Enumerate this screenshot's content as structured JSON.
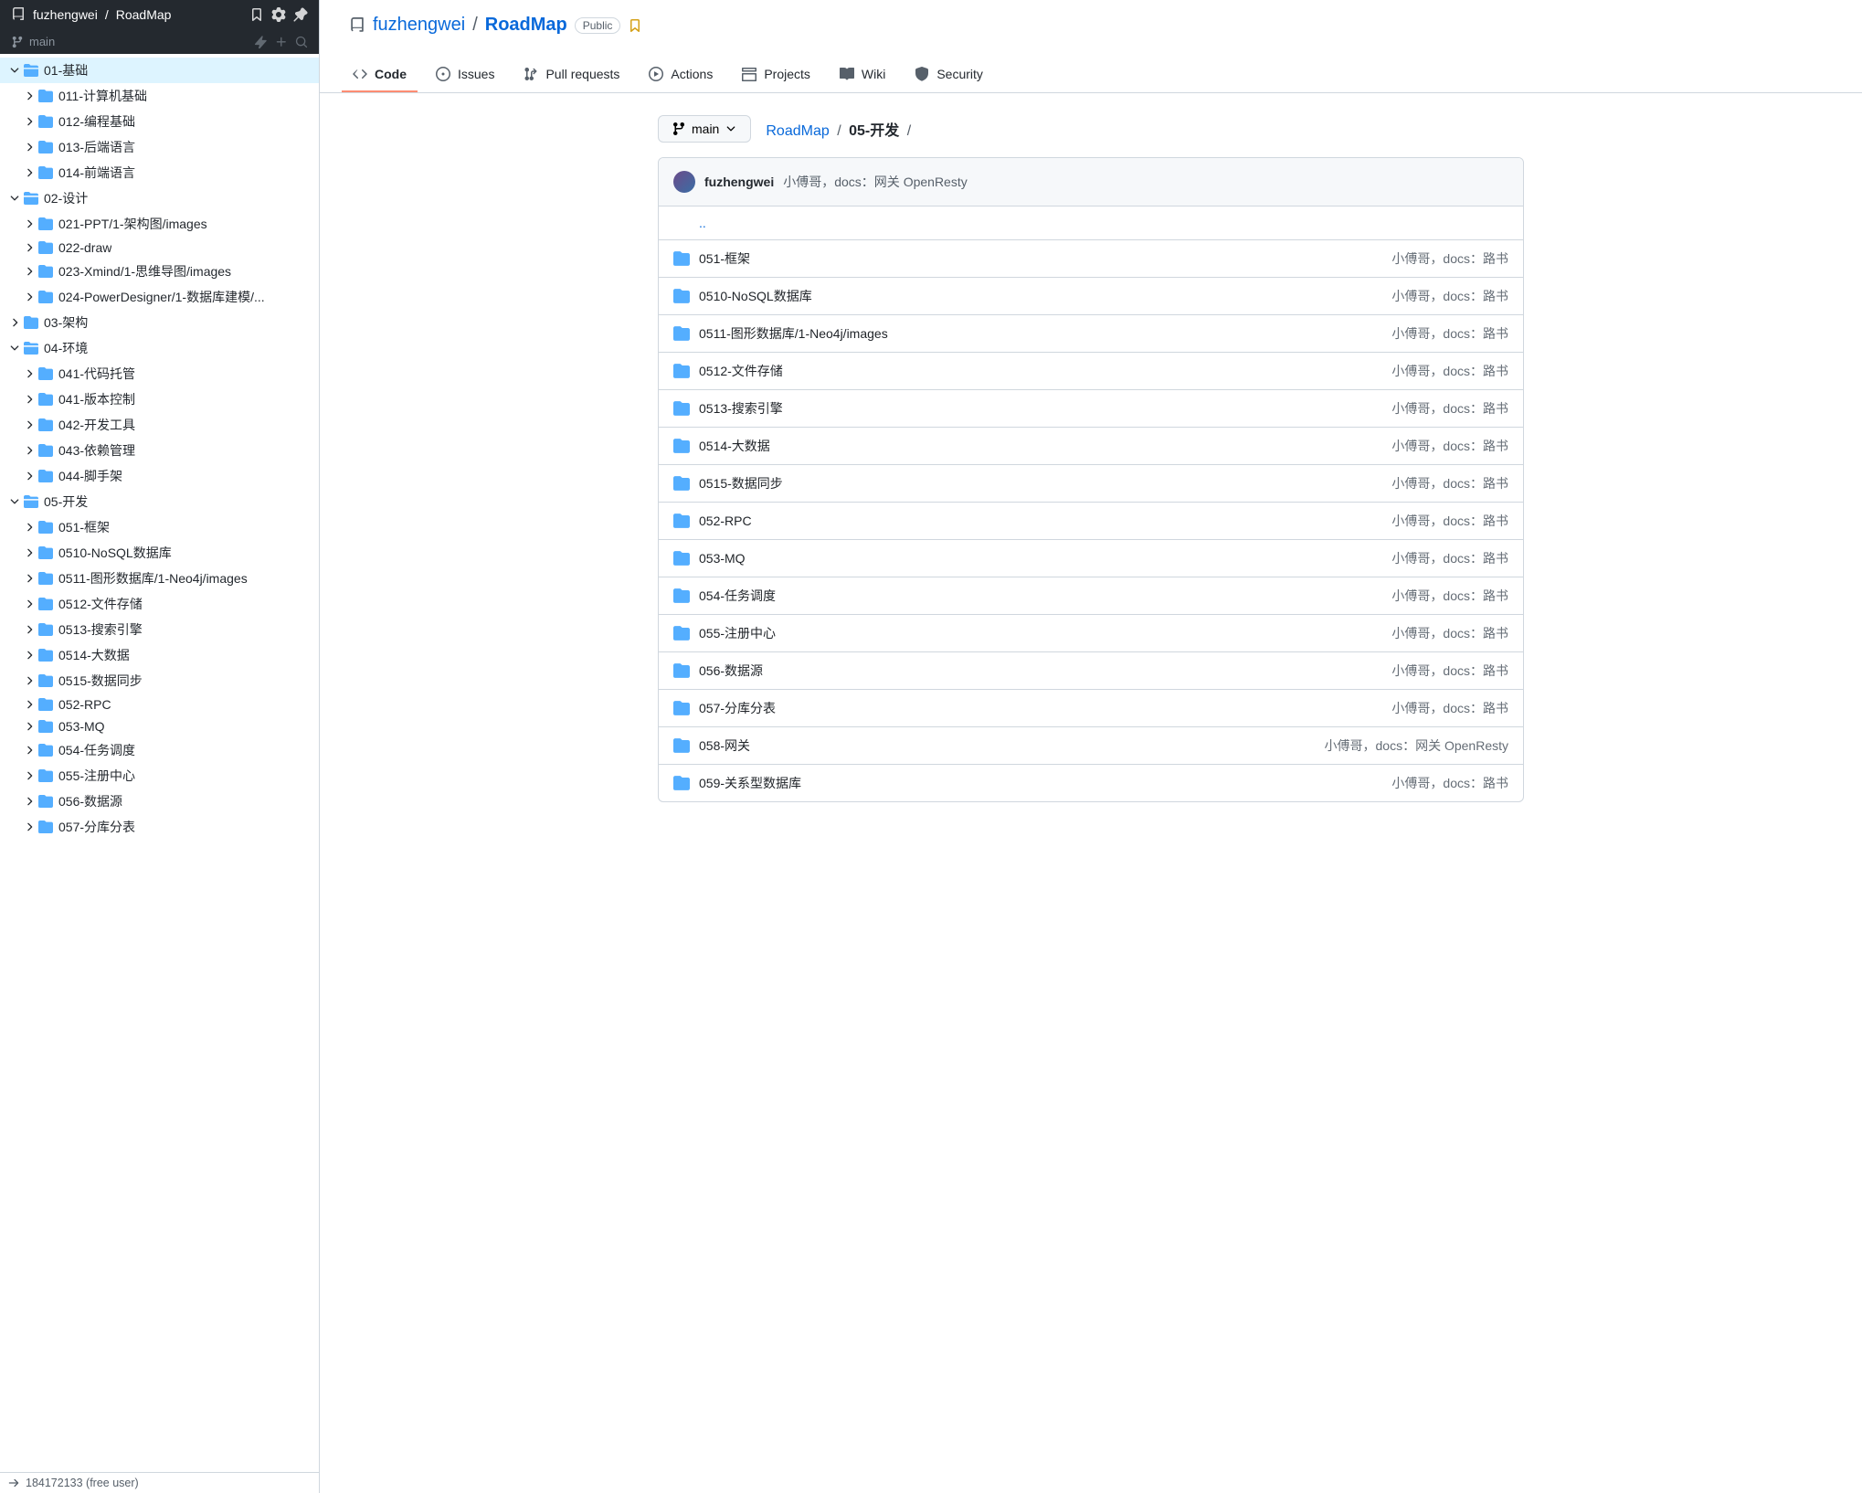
{
  "sidebar": {
    "owner": "fuzhengwei",
    "repo": "RoadMap",
    "branch": "main",
    "tree": [
      {
        "label": "01-基础",
        "depth": 0,
        "expanded": true,
        "selected": true
      },
      {
        "label": "011-计算机基础",
        "depth": 1,
        "expanded": false
      },
      {
        "label": "012-编程基础",
        "depth": 1,
        "expanded": false
      },
      {
        "label": "013-后端语言",
        "depth": 1,
        "expanded": false
      },
      {
        "label": "014-前端语言",
        "depth": 1,
        "expanded": false
      },
      {
        "label": "02-设计",
        "depth": 0,
        "expanded": true
      },
      {
        "label": "021-PPT/1-架构图/images",
        "depth": 1,
        "expanded": false
      },
      {
        "label": "022-draw",
        "depth": 1,
        "expanded": false
      },
      {
        "label": "023-Xmind/1-思维导图/images",
        "depth": 1,
        "expanded": false
      },
      {
        "label": "024-PowerDesigner/1-数据库建模/...",
        "depth": 1,
        "expanded": false
      },
      {
        "label": "03-架构",
        "depth": 0,
        "expanded": false
      },
      {
        "label": "04-环境",
        "depth": 0,
        "expanded": true
      },
      {
        "label": "041-代码托管",
        "depth": 1,
        "expanded": false
      },
      {
        "label": "041-版本控制",
        "depth": 1,
        "expanded": false
      },
      {
        "label": "042-开发工具",
        "depth": 1,
        "expanded": false
      },
      {
        "label": "043-依赖管理",
        "depth": 1,
        "expanded": false
      },
      {
        "label": "044-脚手架",
        "depth": 1,
        "expanded": false
      },
      {
        "label": "05-开发",
        "depth": 0,
        "expanded": true
      },
      {
        "label": "051-框架",
        "depth": 1,
        "expanded": false
      },
      {
        "label": "0510-NoSQL数据库",
        "depth": 1,
        "expanded": false
      },
      {
        "label": "0511-图形数据库/1-Neo4j/images",
        "depth": 1,
        "expanded": false
      },
      {
        "label": "0512-文件存储",
        "depth": 1,
        "expanded": false
      },
      {
        "label": "0513-搜索引擎",
        "depth": 1,
        "expanded": false
      },
      {
        "label": "0514-大数据",
        "depth": 1,
        "expanded": false
      },
      {
        "label": "0515-数据同步",
        "depth": 1,
        "expanded": false
      },
      {
        "label": "052-RPC",
        "depth": 1,
        "expanded": false
      },
      {
        "label": "053-MQ",
        "depth": 1,
        "expanded": false
      },
      {
        "label": "054-任务调度",
        "depth": 1,
        "expanded": false
      },
      {
        "label": "055-注册中心",
        "depth": 1,
        "expanded": false
      },
      {
        "label": "056-数据源",
        "depth": 1,
        "expanded": false
      },
      {
        "label": "057-分库分表",
        "depth": 1,
        "expanded": false
      }
    ]
  },
  "status_bar": "184172133 (free user)",
  "header": {
    "owner": "fuzhengwei",
    "repo": "RoadMap",
    "visibility": "Public"
  },
  "tabs": [
    {
      "label": "Code",
      "active": true
    },
    {
      "label": "Issues"
    },
    {
      "label": "Pull requests"
    },
    {
      "label": "Actions"
    },
    {
      "label": "Projects"
    },
    {
      "label": "Wiki"
    },
    {
      "label": "Security"
    }
  ],
  "branch_button": "main",
  "breadcrumb": {
    "root": "RoadMap",
    "path": "05-开发"
  },
  "last_commit": {
    "author": "fuzhengwei",
    "message": "小傅哥，docs：网关 OpenResty"
  },
  "parent_dir": "..",
  "files": [
    {
      "name": "051-框架",
      "msg": "小傅哥，docs：路书"
    },
    {
      "name": "0510-NoSQL数据库",
      "msg": "小傅哥，docs：路书"
    },
    {
      "name": "0511-图形数据库/1-Neo4j/images",
      "msg": "小傅哥，docs：路书"
    },
    {
      "name": "0512-文件存储",
      "msg": "小傅哥，docs：路书"
    },
    {
      "name": "0513-搜索引擎",
      "msg": "小傅哥，docs：路书"
    },
    {
      "name": "0514-大数据",
      "msg": "小傅哥，docs：路书"
    },
    {
      "name": "0515-数据同步",
      "msg": "小傅哥，docs：路书"
    },
    {
      "name": "052-RPC",
      "msg": "小傅哥，docs：路书"
    },
    {
      "name": "053-MQ",
      "msg": "小傅哥，docs：路书"
    },
    {
      "name": "054-任务调度",
      "msg": "小傅哥，docs：路书"
    },
    {
      "name": "055-注册中心",
      "msg": "小傅哥，docs：路书"
    },
    {
      "name": "056-数据源",
      "msg": "小傅哥，docs：路书"
    },
    {
      "name": "057-分库分表",
      "msg": "小傅哥，docs：路书"
    },
    {
      "name": "058-网关",
      "msg": "小傅哥，docs：网关 OpenResty"
    },
    {
      "name": "059-关系型数据库",
      "msg": "小傅哥，docs：路书"
    }
  ]
}
